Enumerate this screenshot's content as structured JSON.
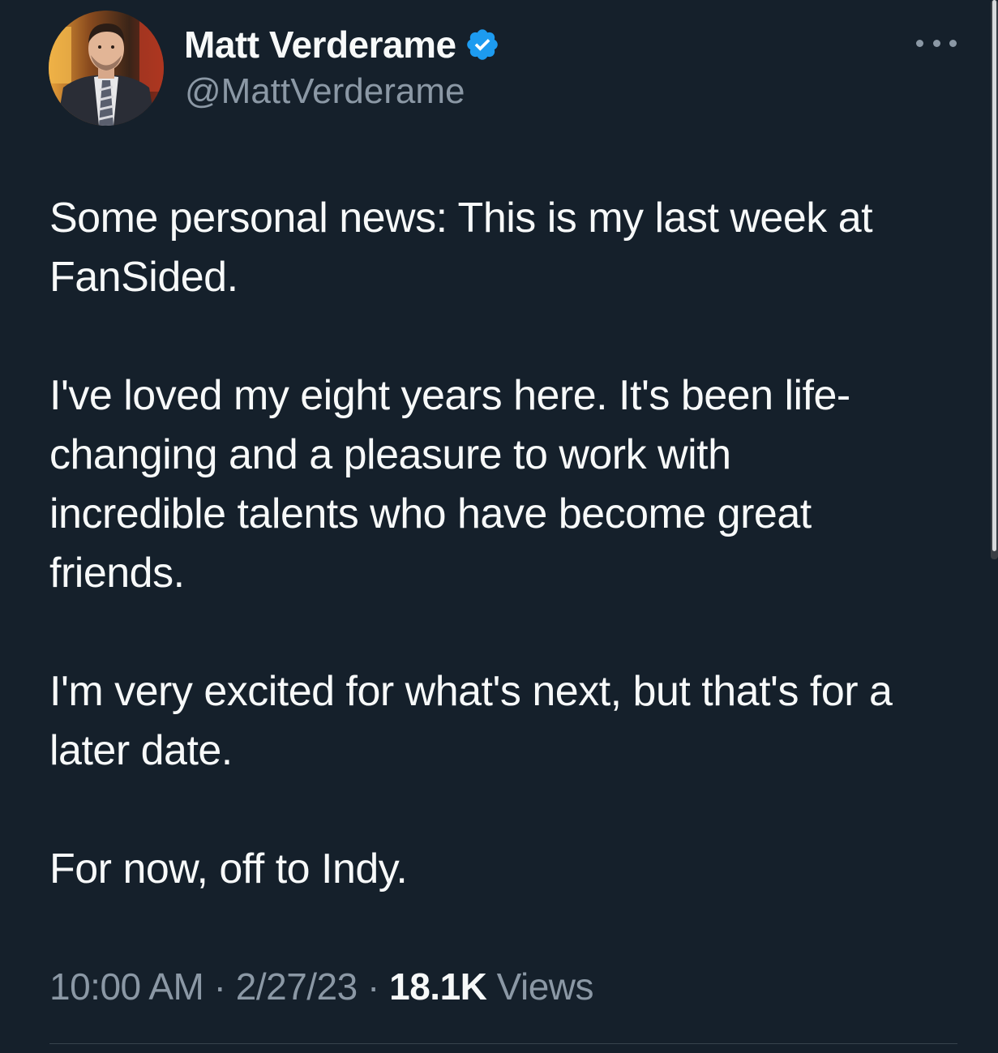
{
  "tweet": {
    "author": {
      "display_name": "Matt Verderame",
      "handle": "@MattVerderame",
      "verified": true,
      "verified_icon": "verified-badge-icon"
    },
    "more_icon": "more-horizontal-icon",
    "body_paragraphs": [
      [
        "Some personal news: This is my last week at",
        "FanSided."
      ],
      [
        "I've loved my eight years here. It's been life-",
        "changing and a pleasure to work with",
        "incredible talents who have become great",
        "friends."
      ],
      [
        "I'm very excited for what's next, but that's for a",
        "later date."
      ],
      [
        "For now, off to Indy."
      ]
    ],
    "meta": {
      "time": "10:00 AM",
      "separator": "·",
      "date": "2/27/23",
      "views_count": "18.1K",
      "views_label": "Views"
    }
  },
  "colors": {
    "background": "#15202b",
    "text_primary": "#f7f9f9",
    "text_secondary": "#8b98a5",
    "verified_blue": "#1d9bf0",
    "divider": "#38444d"
  }
}
